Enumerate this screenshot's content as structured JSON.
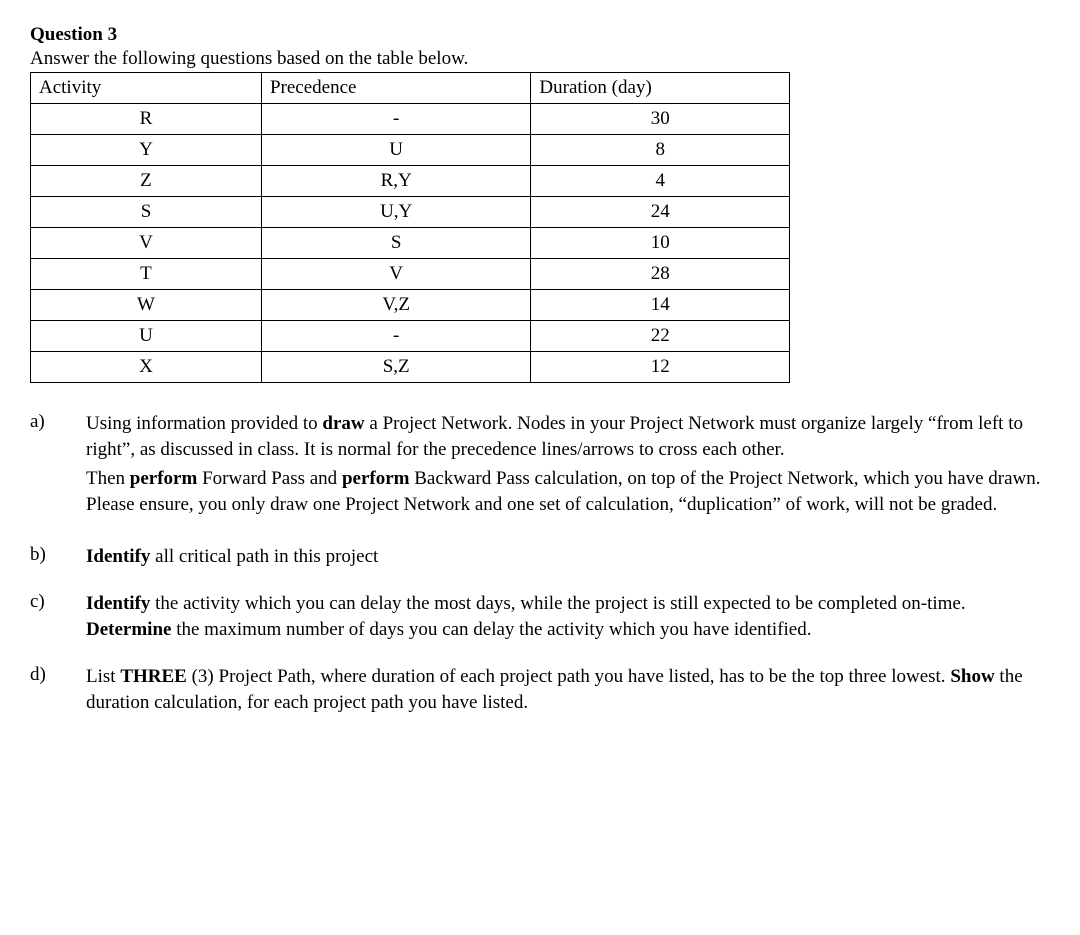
{
  "title": "Question 3",
  "intro": "Answer the following questions based on the table below.",
  "headers": {
    "activity": "Activity",
    "precedence": "Precedence",
    "duration": "Duration (day)"
  },
  "chart_data": {
    "type": "table",
    "columns": [
      "Activity",
      "Precedence",
      "Duration (day)"
    ],
    "rows": [
      {
        "activity": "R",
        "precedence": "-",
        "duration": "30"
      },
      {
        "activity": "Y",
        "precedence": "U",
        "duration": "8"
      },
      {
        "activity": "Z",
        "precedence": "R,Y",
        "duration": "4"
      },
      {
        "activity": "S",
        "precedence": "U,Y",
        "duration": "24"
      },
      {
        "activity": "V",
        "precedence": "S",
        "duration": "10"
      },
      {
        "activity": "T",
        "precedence": "V",
        "duration": "28"
      },
      {
        "activity": "W",
        "precedence": "V,Z",
        "duration": "14"
      },
      {
        "activity": "U",
        "precedence": "-",
        "duration": "22"
      },
      {
        "activity": "X",
        "precedence": "S,Z",
        "duration": "12"
      }
    ]
  },
  "questions": {
    "a": {
      "label": "a)",
      "p1_pre": "Using information provided to ",
      "p1_b1": "draw",
      "p1_mid": " a Project Network. Nodes in your Project Network must organize largely “from left to right”, as discussed in class. It is normal for the precedence lines/arrows to cross each other.",
      "p2_pre": "Then ",
      "p2_b1": "perform",
      "p2_mid1": " Forward Pass and ",
      "p2_b2": "perform",
      "p2_mid2": " Backward Pass calculation, on top of the Project Network, which you have drawn. Please ensure, you only draw one Project Network and one set of calculation, “duplication” of work, will not be graded."
    },
    "b": {
      "label": "b)",
      "b1": "Identify",
      "rest": " all critical path in this project"
    },
    "c": {
      "label": "c)",
      "b1": "Identify",
      "mid1": " the activity which you can delay the most days, while the project is still expected to be completed on-time.  ",
      "b2": "Determine",
      "mid2": " the maximum number of days you can delay the activity which you have identified."
    },
    "d": {
      "label": "d)",
      "pre": "List ",
      "b1": "THREE",
      "mid1": " (3) Project Path, where duration of each project path you have listed, has to be the top three lowest. ",
      "b2": "Show",
      "mid2": " the duration calculation, for each project path you have listed."
    }
  }
}
